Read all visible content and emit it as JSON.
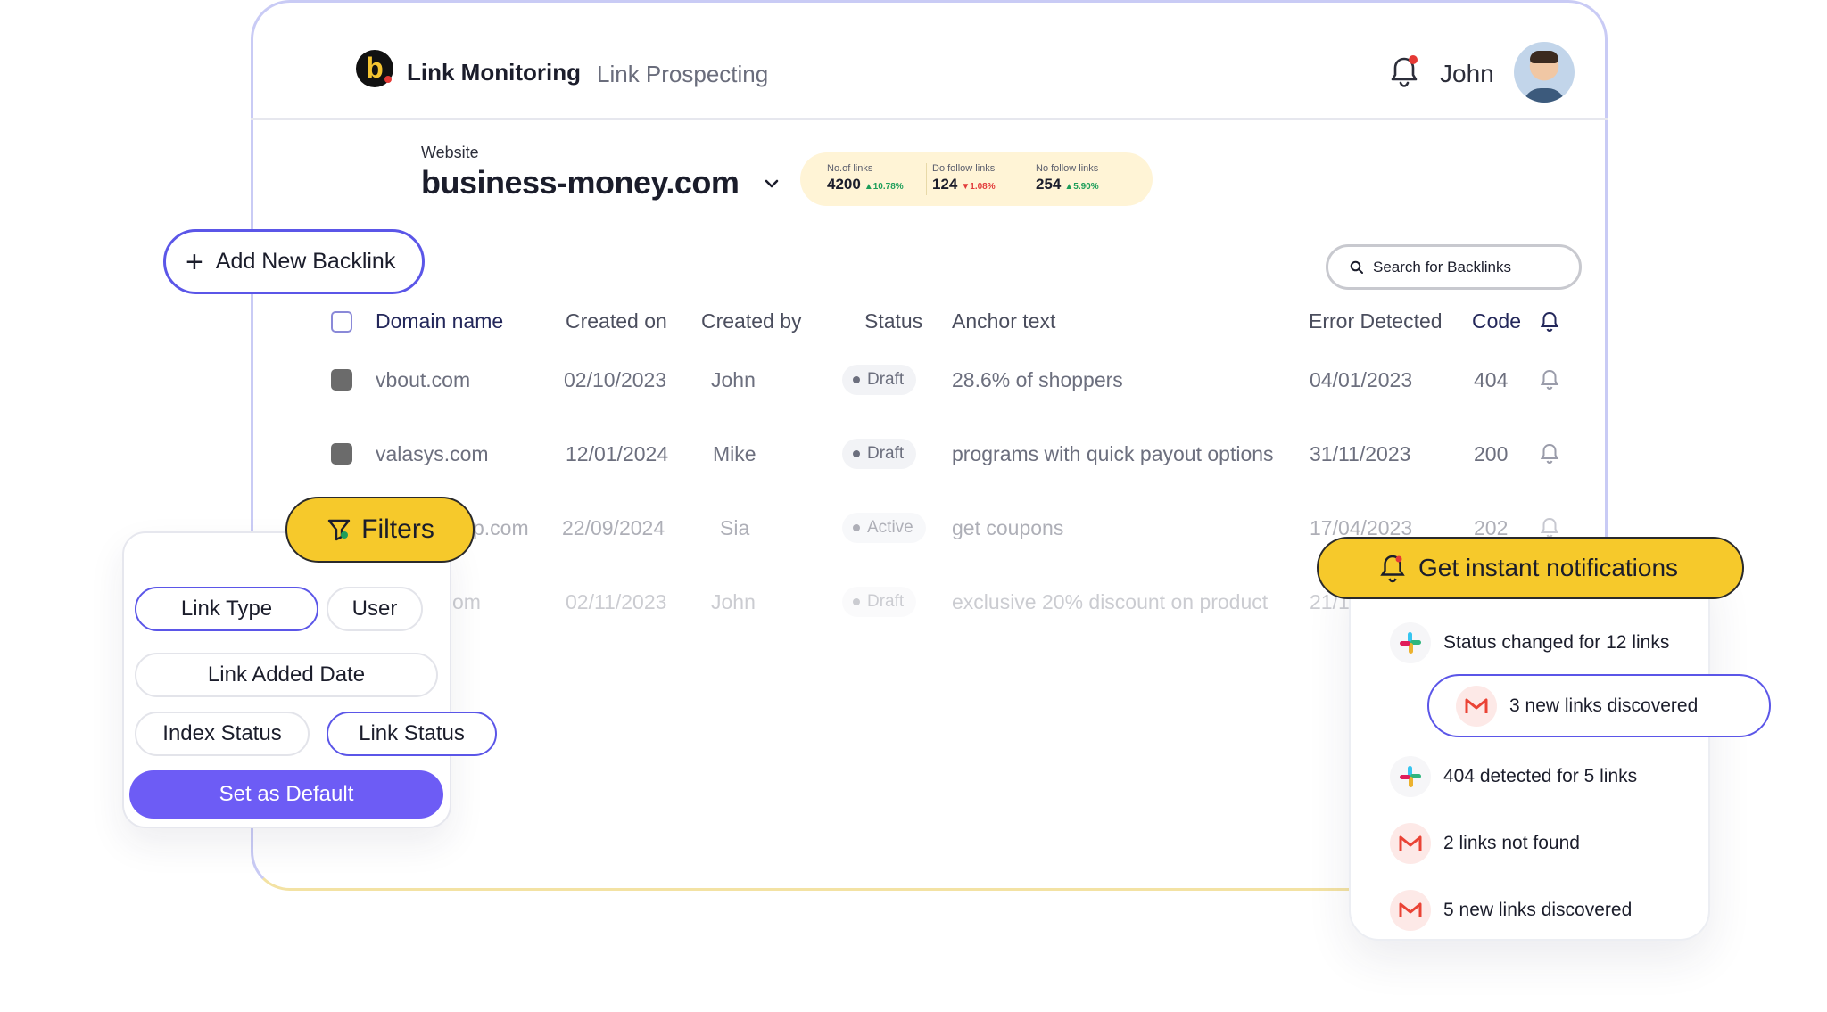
{
  "header": {
    "logo_letter": "b",
    "nav_active": "Link Monitoring",
    "nav_item": "Link Prospecting",
    "user_name": "John"
  },
  "website": {
    "label": "Website",
    "name": "business-money.com"
  },
  "stats": [
    {
      "label": "No.of links",
      "value": "4200",
      "change": "▲10.78%",
      "direction": "up"
    },
    {
      "label": "Do follow links",
      "value": "124",
      "change": "▼1.08%",
      "direction": "down"
    },
    {
      "label": "No follow links",
      "value": "254",
      "change": "▲5.90%",
      "direction": "up"
    }
  ],
  "actions": {
    "add_backlink": "Add New Backlink",
    "search_placeholder": "Search for Backlinks"
  },
  "table": {
    "columns": [
      "Domain name",
      "Created on",
      "Created by",
      "Status",
      "Anchor text",
      "Error Detected",
      "Code"
    ],
    "rows": [
      {
        "domain": "vbout.com",
        "created_on": "02/10/2023",
        "created_by": "John",
        "status": "Draft",
        "anchor": "28.6% of shoppers",
        "error": "04/01/2023",
        "code": "404"
      },
      {
        "domain": "valasys.com",
        "created_on": "12/01/2024",
        "created_by": "Mike",
        "status": "Draft",
        "anchor": "programs with quick payout options",
        "error": "31/11/2023",
        "code": "200"
      },
      {
        "domain": "p.com",
        "created_on": "22/09/2024",
        "created_by": "Sia",
        "status": "Active",
        "anchor": "get coupons",
        "error": "17/04/2023",
        "code": "202"
      },
      {
        "domain": "om",
        "created_on": "02/11/2023",
        "created_by": "John",
        "status": "Draft",
        "anchor": "exclusive 20% discount on product",
        "error": "21/1",
        "code": ""
      }
    ]
  },
  "filters": {
    "title": "Filters",
    "chips": [
      "Link Type",
      "User",
      "Link Added Date",
      "Index Status",
      "Link Status"
    ],
    "default_button": "Set as Default"
  },
  "notifications": {
    "title": "Get instant notifications",
    "items": [
      {
        "text": "Status changed for 12 links",
        "icon": "slack-icon"
      },
      {
        "text": "3 new links discovered",
        "icon": "gmail-icon"
      },
      {
        "text": "404 detected for 5 links",
        "icon": "slack-icon"
      },
      {
        "text": "2 links not found",
        "icon": "gmail-icon"
      },
      {
        "text": "5 new links discovered",
        "icon": "gmail-icon"
      }
    ]
  },
  "colors": {
    "accent": "#5b56e8",
    "primary_button": "#6d5cf5",
    "highlight_yellow": "#f6c92b",
    "stats_bg": "#fff4d6"
  }
}
